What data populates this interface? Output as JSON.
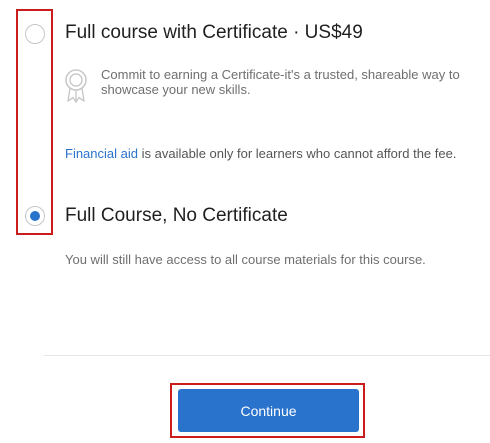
{
  "options": [
    {
      "title": "Full course with Certificate · US$49",
      "selected": false,
      "icon": "certificate-ribbon-icon",
      "description": "Commit to earning a Certificate-it's a trusted, shareable way to showcase your new skills."
    },
    {
      "title": "Full Course, No Certificate",
      "selected": true,
      "description": "You will still have access to all course materials for this course."
    }
  ],
  "financial_aid": {
    "link_text": "Financial aid",
    "rest_text": " is available only for learners who cannot afford the fee."
  },
  "continue_button": {
    "label": "Continue"
  },
  "colors": {
    "accent": "#2a73cc",
    "highlight": "#cc1d1d",
    "title_text": "#1f1f1f",
    "muted_text": "#6f6f6f"
  }
}
